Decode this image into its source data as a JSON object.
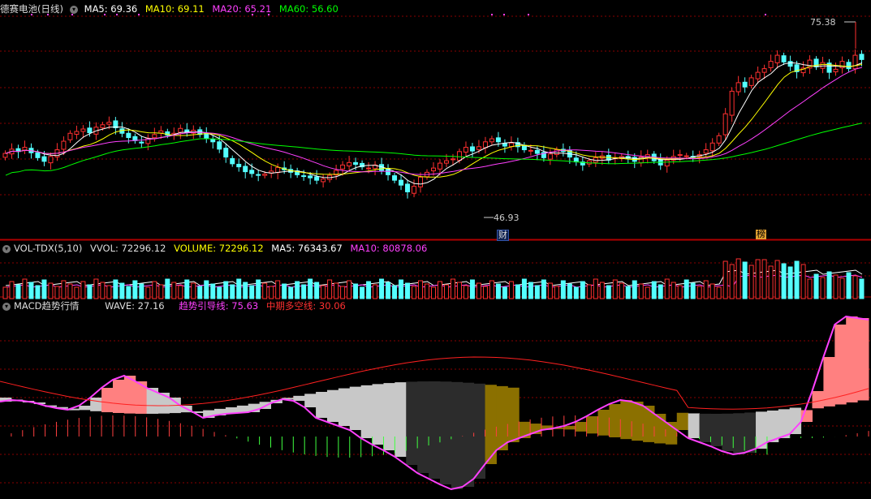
{
  "main_panel": {
    "stock_name": "德赛电池",
    "period": "(日线)",
    "ma": [
      {
        "label": "MA5: 69.36",
        "color": "#ffffff"
      },
      {
        "label": "MA10: 69.11",
        "color": "#ffff00"
      },
      {
        "label": "MA20: 65.21",
        "color": "#ff40ff"
      },
      {
        "label": "MA60: 56.60",
        "color": "#00ff00"
      }
    ],
    "high_label": "75.38",
    "low_label": "46.93",
    "event_tags": [
      {
        "text": "财",
        "kind": "finance"
      },
      {
        "text": "榜",
        "kind": "ranking"
      }
    ]
  },
  "volume_panel": {
    "name": "VOL-TDX(5,10)",
    "items": [
      {
        "label": "VVOL: 72296.12",
        "color": "#dddddd"
      },
      {
        "label": "VOLUME: 72296.12",
        "color": "#ffff00"
      },
      {
        "label": "MA5: 76343.67",
        "color": "#ffffff"
      },
      {
        "label": "MA10: 80878.06",
        "color": "#ff40ff"
      }
    ]
  },
  "macd_panel": {
    "name": "MACD趋势行情",
    "items": [
      {
        "label": "WAVE: 27.16",
        "color": "#dddddd"
      },
      {
        "label": "趋势引导线: 75.63",
        "color": "#ff40ff"
      },
      {
        "label": "中期多空线: 30.06",
        "color": "#ff3030"
      }
    ]
  },
  "colors": {
    "up": "#ff3030",
    "down": "#54ffff",
    "grid": "#8a0000",
    "ma5": "#ffffff",
    "ma10": "#ffff00",
    "ma20": "#ff40ff",
    "ma60": "#00ff00",
    "band_pink": "#ff8080",
    "band_gray": "#c8c8c8",
    "band_olive": "#8b7000",
    "band_dark": "#2c2c2c"
  },
  "chart_data": {
    "type": "candlestick",
    "price_range": [
      44,
      79
    ],
    "closes": [
      56.5,
      57.2,
      56.8,
      57.5,
      56.6,
      55.8,
      55.2,
      56.0,
      57.1,
      58.5,
      59.8,
      60.1,
      60.5,
      59.9,
      60.8,
      61.2,
      61.6,
      60.7,
      59.8,
      59.1,
      58.6,
      58.2,
      59.0,
      59.6,
      60.2,
      59.5,
      59.8,
      60.6,
      59.9,
      60.3,
      59.6,
      59.0,
      58.4,
      57.2,
      55.9,
      54.8,
      54.3,
      53.5,
      53.2,
      52.9,
      53.1,
      53.6,
      54.2,
      53.8,
      53.4,
      53.0,
      52.8,
      52.5,
      52.1,
      52.3,
      52.9,
      53.7,
      54.6,
      55.0,
      54.7,
      54.3,
      54.1,
      54.6,
      53.7,
      53.0,
      52.1,
      51.3,
      50.2,
      51.1,
      52.6,
      53.4,
      54.1,
      54.9,
      55.3,
      55.6,
      56.8,
      57.5,
      56.9,
      57.6,
      58.4,
      58.9,
      58.4,
      57.7,
      58.2,
      57.6,
      57.1,
      57.0,
      56.5,
      55.8,
      56.4,
      57.1,
      56.8,
      55.9,
      55.1,
      54.6,
      55.3,
      55.8,
      56.1,
      55.4,
      55.8,
      56.0,
      55.7,
      55.2,
      55.9,
      56.3,
      55.3,
      54.6,
      55.4,
      56.0,
      56.3,
      56.1,
      55.9,
      56.3,
      57.1,
      58.2,
      59.4,
      63.0,
      66.7,
      68.1,
      67.4,
      68.9,
      69.8,
      70.4,
      71.6,
      72.6,
      71.5,
      70.8,
      69.9,
      70.5,
      71.8,
      70.7,
      71.4,
      69.8,
      70.3,
      71.6,
      70.4,
      72.6,
      71.9
    ],
    "ma5_last": 69.36,
    "ma10_last": 69.11,
    "ma20_last": 65.21,
    "ma60_last": 56.6,
    "volume_last": 72296.12,
    "volume_ma5": 76343.67,
    "volume_ma10": 80878.06,
    "wave_last": 27.16,
    "trend_guide_last": 75.63,
    "midterm_line_last": 30.06
  }
}
